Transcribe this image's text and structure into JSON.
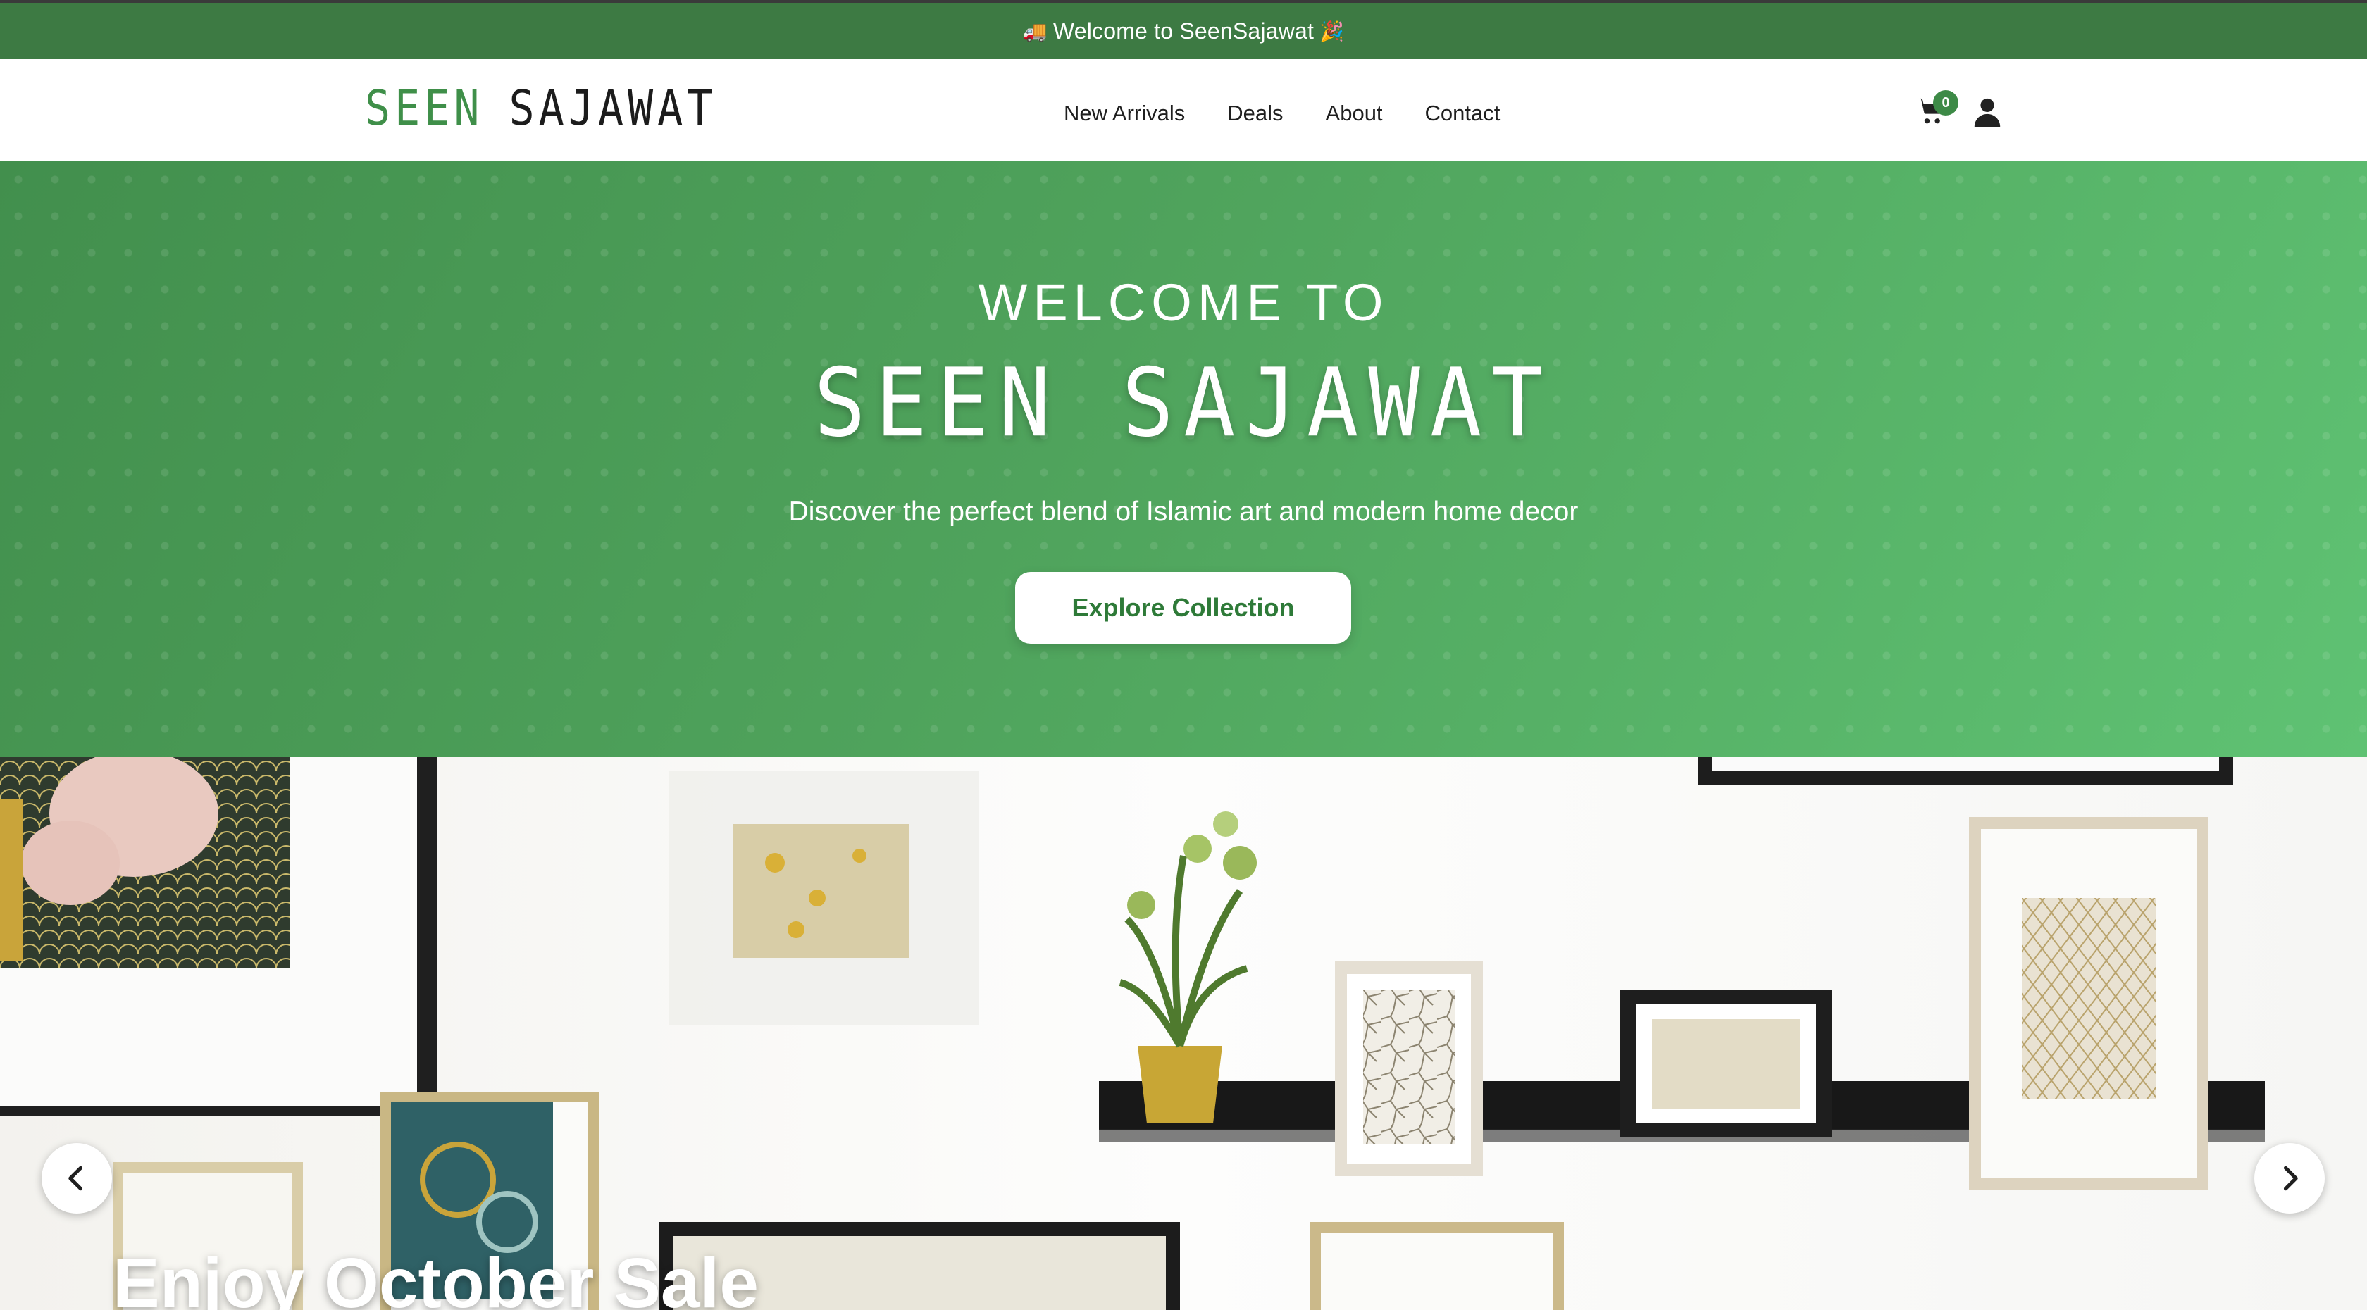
{
  "announcement": {
    "left_emoji": "🚚",
    "text": "Welcome to SeenSajawat",
    "right_emoji": "🎉"
  },
  "header": {
    "logo_word1": "SEEN",
    "logo_word2": "SAJAWAT",
    "nav": [
      "New Arrivals",
      "Deals",
      "About",
      "Contact"
    ],
    "cart_count": "0",
    "cart_icon": "cart-icon",
    "user_icon": "user-icon"
  },
  "hero": {
    "welcome": "WELCOME TO",
    "brand": "SEEN SAJAWAT",
    "subtitle": "Discover the perfect blend of Islamic art and modern home decor",
    "button": "Explore Collection"
  },
  "carousel": {
    "slide_title": "Enjoy October Sale",
    "prev_icon": "chevron-left-icon",
    "next_icon": "chevron-right-icon"
  },
  "colors": {
    "accent_green": "#3d7a43",
    "hero_start": "#428f4d",
    "hero_end": "#5fc273",
    "button_text": "#2e7a38"
  }
}
